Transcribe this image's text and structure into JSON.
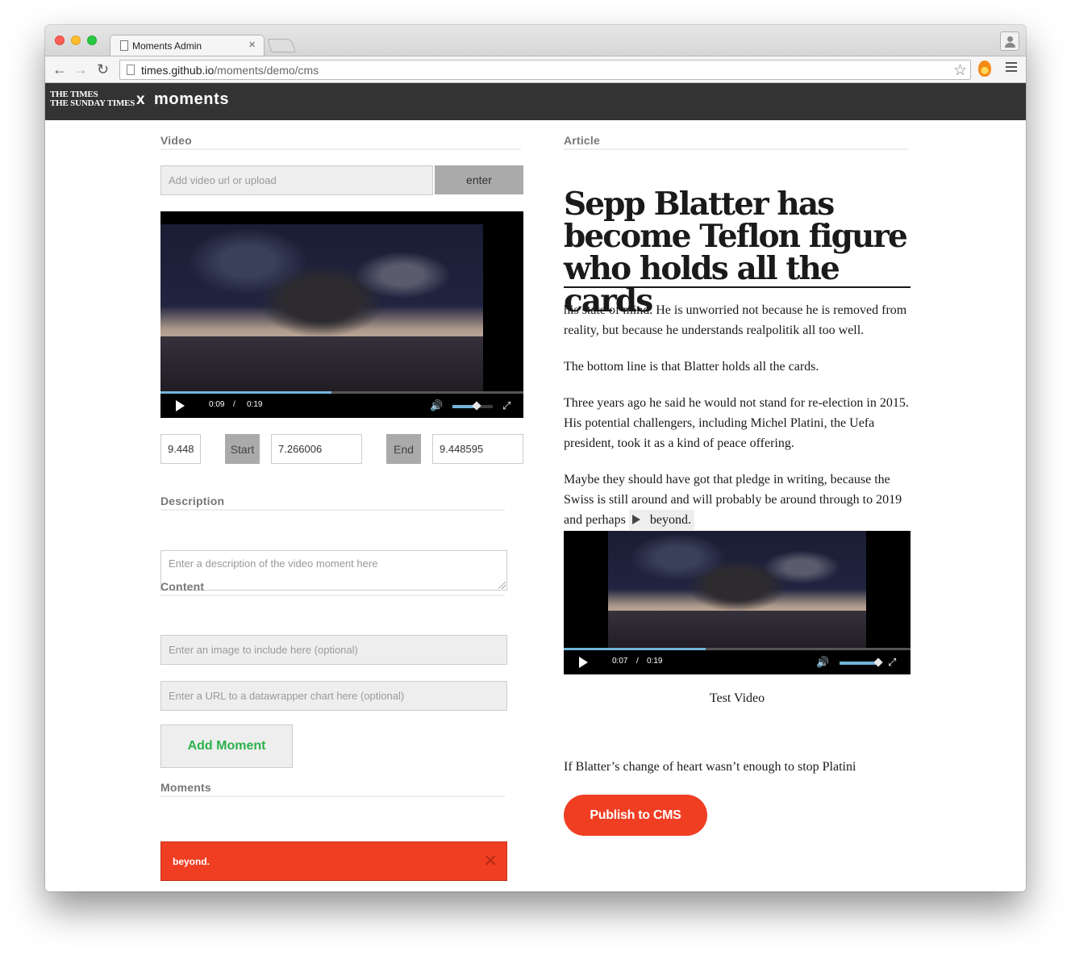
{
  "browser": {
    "tab_title": "Moments Admin",
    "tab_close": "×",
    "url_host": "times.github.io",
    "url_path": "/moments/demo/cms",
    "back_glyph": "←",
    "forward_glyph": "→",
    "reload_glyph": "↻",
    "star_glyph": "☆"
  },
  "header": {
    "logo_line1": "THE TIMES",
    "logo_line2": "THE SUNDAY TIMES",
    "separator": "x",
    "app_name": "moments"
  },
  "video_section": {
    "label": "Video",
    "url_placeholder": "Add video url or upload",
    "enter_label": "enter",
    "player": {
      "current_time": "0:09",
      "separator": "/",
      "duration": "0:19",
      "progress_fraction": 0.47,
      "volume_fraction": 0.6
    },
    "current_value": "9.448",
    "start_label": "Start",
    "start_value": "7.266006",
    "end_label": "End",
    "end_value": "9.448595"
  },
  "description_section": {
    "label": "Description",
    "placeholder": "Enter a description of the video moment here"
  },
  "content_section": {
    "label": "Content",
    "image_placeholder": "Enter an image to include here (optional)",
    "chart_placeholder": "Enter a URL to a datawrapper chart here (optional)",
    "add_button": "Add Moment"
  },
  "moments_section": {
    "label": "Moments",
    "items": [
      {
        "label": "beyond.",
        "remove_glyph": "✕"
      }
    ]
  },
  "article": {
    "label": "Article",
    "headline": "Sepp Blatter has become Teflon figure who holds all the cards",
    "paragraphs": [
      "his state of mind. He is unworried not because he is removed from reality, but because he understands realpolitik all too well.",
      "The bottom line is that Blatter holds all the cards.",
      "Three years ago he said he would not stand for re-election in 2015. His potential challengers, including Michel Platini, the Uefa president, took it as a kind of peace offering.",
      "Maybe they should have got that pledge in writing, because the Swiss is still around and will probably be around through to 2019 and perhaps"
    ],
    "marker_text": "beyond.",
    "player": {
      "current_time": "0:07",
      "separator": "/",
      "duration": "0:19",
      "progress_fraction": 0.41,
      "volume_fraction": 0.95
    },
    "caption": "Test Video",
    "after_paragraph": "If Blatter’s change of heart wasn’t enough to stop Platini",
    "publish_button": "Publish to CMS"
  },
  "colors": {
    "accent_red": "#f03e22",
    "add_green": "#2bb24c",
    "header_bg": "#333333",
    "progress_blue": "#71b4d8"
  }
}
